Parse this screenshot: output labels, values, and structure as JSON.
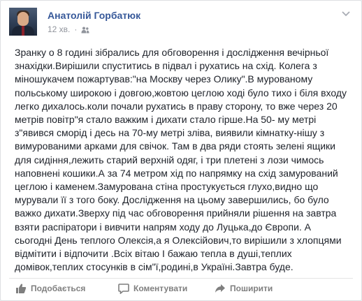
{
  "post": {
    "author": "Анатолій Горбатюк",
    "time": "12 хв.",
    "privacy_icon": "friends-icon",
    "text": "Зранку о 8 годині зібрались для обговорення і дослідження вечірньої\nзнахідки.Вирішили спуститись в підвал і рухатись на схід. Колега з\nміношукачем пожартував:\"на Москву через Олику\".В мурованому\nпольському широкою і довгою,жовтою цеглою ході було тихо і біля входу\nлегко дихалось.коли почали рухатись в праву сторону, то вже через 20\nметрів повітр\"я стало важким і дихати стало гірше.На 50- му метрі\nз\"явився сморід і десь на 70-му метрі зліва, виявили кімнатку-нішу з\nвимурованими арками для свічок. Там в два ряди стоять зелені ящики\nдля сидіння,лежить старий верхній одяг, і три плетені з лози чимось\nнаповнені кошики.А за 74 метром хід по напрямку на схід замурований\nцеглою і каменем.Замурована стіна простукується глухо,видно що\nмурували її з того боку. Дослідження на цьому завершились, бо було\nважко дихати.Зверху під час обговорення прийняли рішення на завтра\nвзяти распіратори і вивчити напрям ходу до Луцька,до Європи. А\nсьогодні День теплого Олексія,а я Олексійович,то вирішили з хлопцями\nвідмітити і відпочити .Всіх вітаю І бажаю тепла в душі,теплих\nдомівок,теплих стосунків в сім\"ї,родині,в Україні.Завтра буде."
  },
  "actions": {
    "like_label": "Подобається",
    "comment_label": "Коментувати",
    "share_label": "Поширити"
  },
  "colors": {
    "author_link": "#365899",
    "meta_gray": "#90949c",
    "action_gray": "#7f7f7f",
    "text": "#1d2129"
  }
}
